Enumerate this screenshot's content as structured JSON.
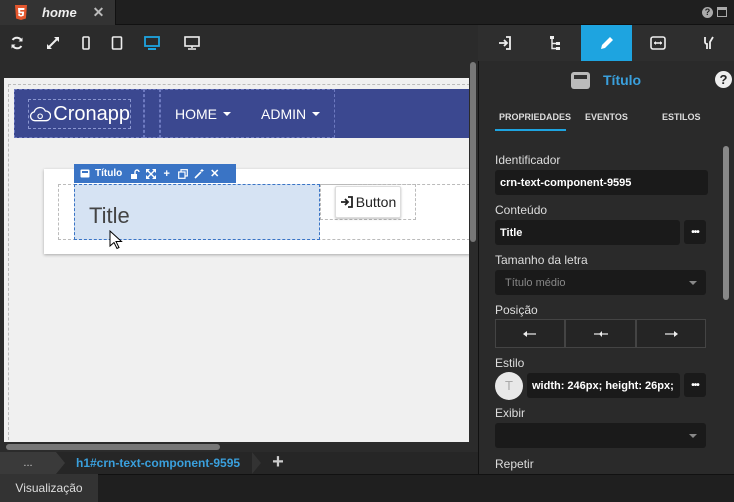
{
  "tab": {
    "name": "home",
    "close": "✕"
  },
  "canvas": {
    "brand": "Cronapp",
    "nav": [
      "HOME",
      "ADMIN"
    ],
    "selection_label": "Título",
    "title_text": "Title",
    "button_label": "Button"
  },
  "breadcrumb": {
    "dots": "...",
    "current": "h1#crn-text-component-9595",
    "add": "+"
  },
  "status": {
    "tab": "Visualização"
  },
  "panel": {
    "component_title": "Título",
    "help": "?",
    "subtabs": [
      "PROPRIEDADES",
      "EVENTOS",
      "ESTILOS"
    ],
    "fields": {
      "identificador_label": "Identificador",
      "identificador_value": "crn-text-component-9595",
      "conteudo_label": "Conteúdo",
      "conteudo_value": "Title",
      "tamanho_label": "Tamanho da letra",
      "tamanho_placeholder": "Título médio",
      "posicao_label": "Posição",
      "estilo_label": "Estilo",
      "estilo_avatar": "T",
      "estilo_value": "width: 246px; height: 26px;",
      "exibir_label": "Exibir",
      "exibir_value": "",
      "repetir_label": "Repetir"
    },
    "dots": "•••"
  },
  "colors": {
    "accent": "#1ea4e0",
    "navbar": "#3b4890",
    "selection": "#3a74c5"
  }
}
